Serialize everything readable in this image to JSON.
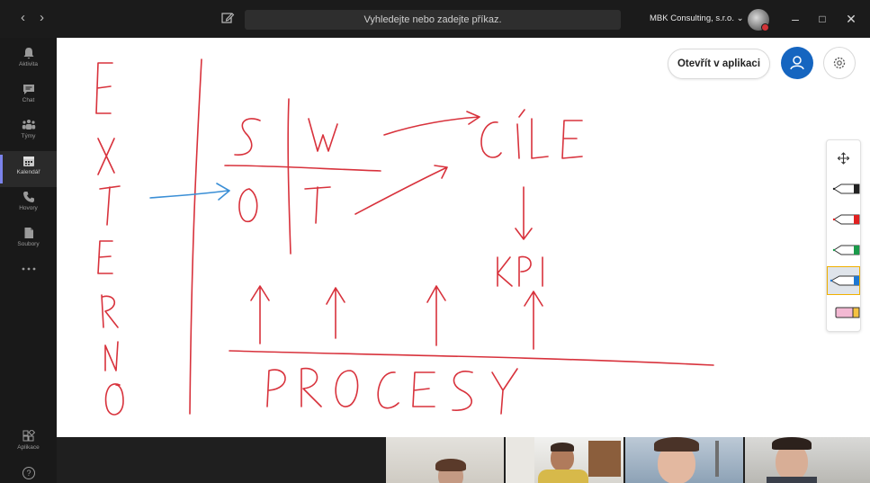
{
  "titlebar": {
    "back_icon": "chevron-left-icon",
    "forward_icon": "chevron-right-icon",
    "compose_icon": "compose-icon",
    "search_placeholder": "Vyhledejte nebo zadejte příkaz.",
    "org_label": "MBK Consulting, s.r.o. ⌄",
    "status_color": "#d13438"
  },
  "rail": {
    "items": [
      {
        "label": "Aktivita",
        "icon": "bell-icon"
      },
      {
        "label": "Chat",
        "icon": "chat-icon"
      },
      {
        "label": "Týmy",
        "icon": "teams-icon"
      },
      {
        "label": "Kalendář",
        "icon": "calendar-icon",
        "active": true
      },
      {
        "label": "Hovory",
        "icon": "phone-icon"
      },
      {
        "label": "Soubory",
        "icon": "file-icon"
      },
      {
        "label": "",
        "icon": "more-icon"
      }
    ],
    "apps_label": "Aplikace",
    "help_icon": "help-icon"
  },
  "whiteboard": {
    "open_app_label": "Otevřít v aplikaci",
    "person_icon": "person-icon",
    "settings_icon": "gear-icon",
    "ink_color": "#d8323c",
    "arrow_color": "#3b8fd6",
    "tools": [
      {
        "name": "move-icon"
      },
      {
        "name": "black-pen-icon",
        "color": "#222222"
      },
      {
        "name": "red-pen-icon",
        "color": "#e02020"
      },
      {
        "name": "green-pen-icon",
        "color": "#1a9a4a"
      },
      {
        "name": "blue-pen-icon",
        "color": "#1e78d2",
        "selected": true
      },
      {
        "name": "eraser-icon",
        "color": "#f3b9d3"
      }
    ]
  },
  "participants": {
    "count": 4
  }
}
